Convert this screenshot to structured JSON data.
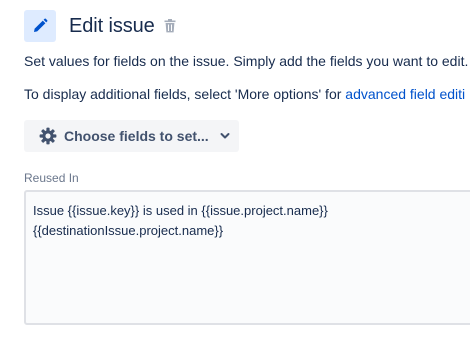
{
  "header": {
    "title": "Edit issue",
    "edit_icon": "pencil-icon",
    "delete_icon": "trash-icon"
  },
  "description": {
    "line1": "Set values for fields on the issue. Simply add the fields you want to edit.",
    "line2_prefix": "To display additional fields, select 'More options' for ",
    "line2_link": "advanced field editi"
  },
  "choose_fields": {
    "label": "Choose fields to set...",
    "icon": "gear-icon",
    "chevron_icon": "chevron-down-icon"
  },
  "field": {
    "label": "Reused In",
    "value_lines": [
      "Issue {{issue.key}} is used in {{issue.project.name}}",
      "{{destinationIssue.project.name}}"
    ]
  },
  "colors": {
    "accent": "#0052cc",
    "icon_bg": "#deebff",
    "text": "#172b4d",
    "muted": "#6b778c",
    "button_bg": "#f4f5f7"
  }
}
